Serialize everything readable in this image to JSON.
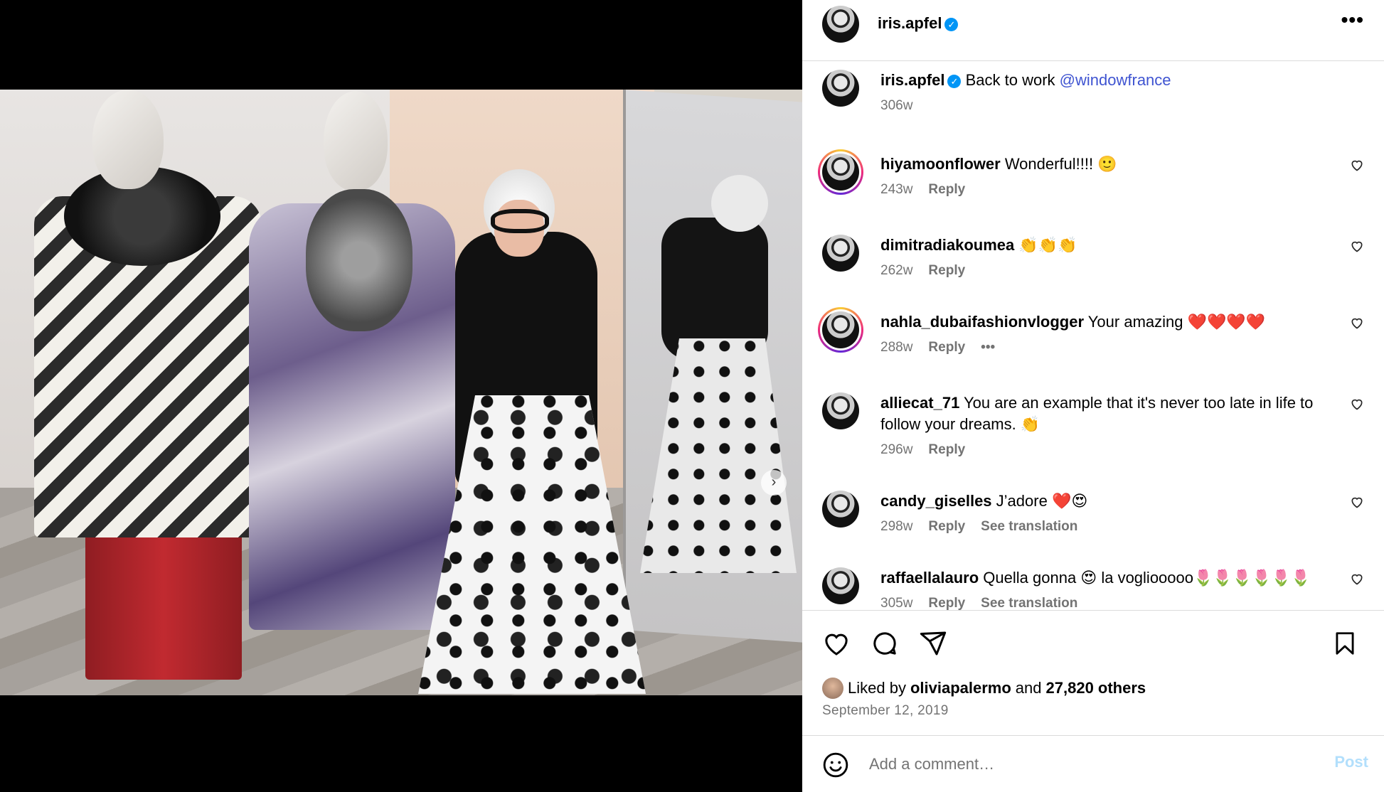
{
  "post": {
    "username": "iris.apfel",
    "verified_icon": "✓",
    "more_label": "•••",
    "caption": {
      "username": "iris.apfel",
      "text": "Back to work",
      "mention": "@windowfrance",
      "age": "306w"
    }
  },
  "comments": [
    {
      "username": "hiyamoonflower",
      "text": "Wonderful!!!! 🙂",
      "age": "243w",
      "reply": "Reply",
      "extra": "",
      "has_ring": true
    },
    {
      "username": "dimitradiakoumea",
      "text": "👏👏👏",
      "age": "262w",
      "reply": "Reply",
      "extra": "",
      "has_ring": false
    },
    {
      "username": "nahla_dubaifashionvlogger",
      "text": "Your amazing ❤️❤️❤️❤️",
      "age": "288w",
      "reply": "Reply",
      "extra": "•••",
      "has_ring": true
    },
    {
      "username": "alliecat_71",
      "text": "You are an example that it's never too late in life to follow your dreams. 👏",
      "age": "296w",
      "reply": "Reply",
      "extra": "",
      "has_ring": false
    },
    {
      "username": "candy_giselles",
      "text": "J’adore ❤️😍",
      "age": "298w",
      "reply": "Reply",
      "extra": "See translation",
      "has_ring": false
    },
    {
      "username": "raffaellalauro",
      "text": "Quella gonna 😍 la vogliooooo🌷🌷🌷🌷🌷🌷",
      "age": "305w",
      "reply": "Reply",
      "extra": "See translation",
      "has_ring": false
    }
  ],
  "likes": {
    "prefix": "Liked by",
    "user": "oliviapalermo",
    "joiner": "and",
    "others": "27,820 others"
  },
  "date": "September 12, 2019",
  "composer": {
    "placeholder": "Add a comment…",
    "post_label": "Post"
  },
  "carousel": {
    "next_glyph": "›",
    "total_slides": 2,
    "active_slide": 1
  },
  "colors": {
    "accent": "#0095f6",
    "mention": "#3f54d1",
    "muted": "#737373",
    "post_disabled": "#b2dffc"
  }
}
